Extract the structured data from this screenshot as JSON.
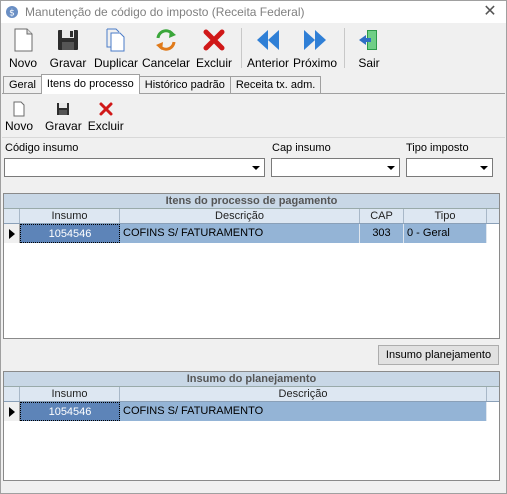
{
  "window": {
    "title": "Manutenção de código do imposto (Receita Federal)",
    "close_glyph": "✕"
  },
  "toolbar": {
    "buttons": [
      {
        "label": "Novo",
        "icon": "new-document-icon"
      },
      {
        "label": "Gravar",
        "icon": "floppy-save-icon"
      },
      {
        "label": "Duplicar",
        "icon": "duplicate-icon"
      },
      {
        "label": "Cancelar",
        "icon": "cancel-arrows-icon"
      },
      {
        "label": "Excluir",
        "icon": "red-x-delete-icon"
      },
      {
        "label": "Anterior",
        "icon": "double-left-arrow-icon"
      },
      {
        "label": "Próximo",
        "icon": "double-right-arrow-icon"
      },
      {
        "label": "Sair",
        "icon": "exit-door-icon"
      }
    ]
  },
  "tabs": [
    {
      "label": "Geral",
      "active": false
    },
    {
      "label": "Itens do processo",
      "active": true
    },
    {
      "label": "Histórico padrão",
      "active": false
    },
    {
      "label": "Receita tx. adm.",
      "active": false
    }
  ],
  "subtoolbar": {
    "new_label": "Novo",
    "save_label": "Gravar",
    "delete_label": "Excluir"
  },
  "filters": {
    "codigo_insumo_label": "Código insumo",
    "codigo_insumo_value": "",
    "cap_insumo_label": "Cap insumo",
    "cap_insumo_value": "",
    "tipo_imposto_label": "Tipo imposto",
    "tipo_imposto_value": ""
  },
  "grid_itens": {
    "title": "Itens do processo de pagamento",
    "columns": [
      "Insumo",
      "Descrição",
      "CAP",
      "Tipo"
    ],
    "rows": [
      {
        "insumo": "1054546",
        "descricao": "COFINS S/ FATURAMENTO",
        "cap": "303",
        "tipo": "0 - Geral"
      }
    ]
  },
  "insumo_planejamento_button": "Insumo planejamento",
  "grid_planejamento": {
    "title": "Insumo do planejamento",
    "columns": [
      "Insumo",
      "Descrição"
    ],
    "rows": [
      {
        "insumo": "1054546",
        "descricao": "COFINS S/ FATURAMENTO"
      }
    ]
  },
  "colors": {
    "row_fill": "#94b4d6",
    "selected_cell": "#5d84b8",
    "grid_title_bg": "#c8d7e6"
  }
}
